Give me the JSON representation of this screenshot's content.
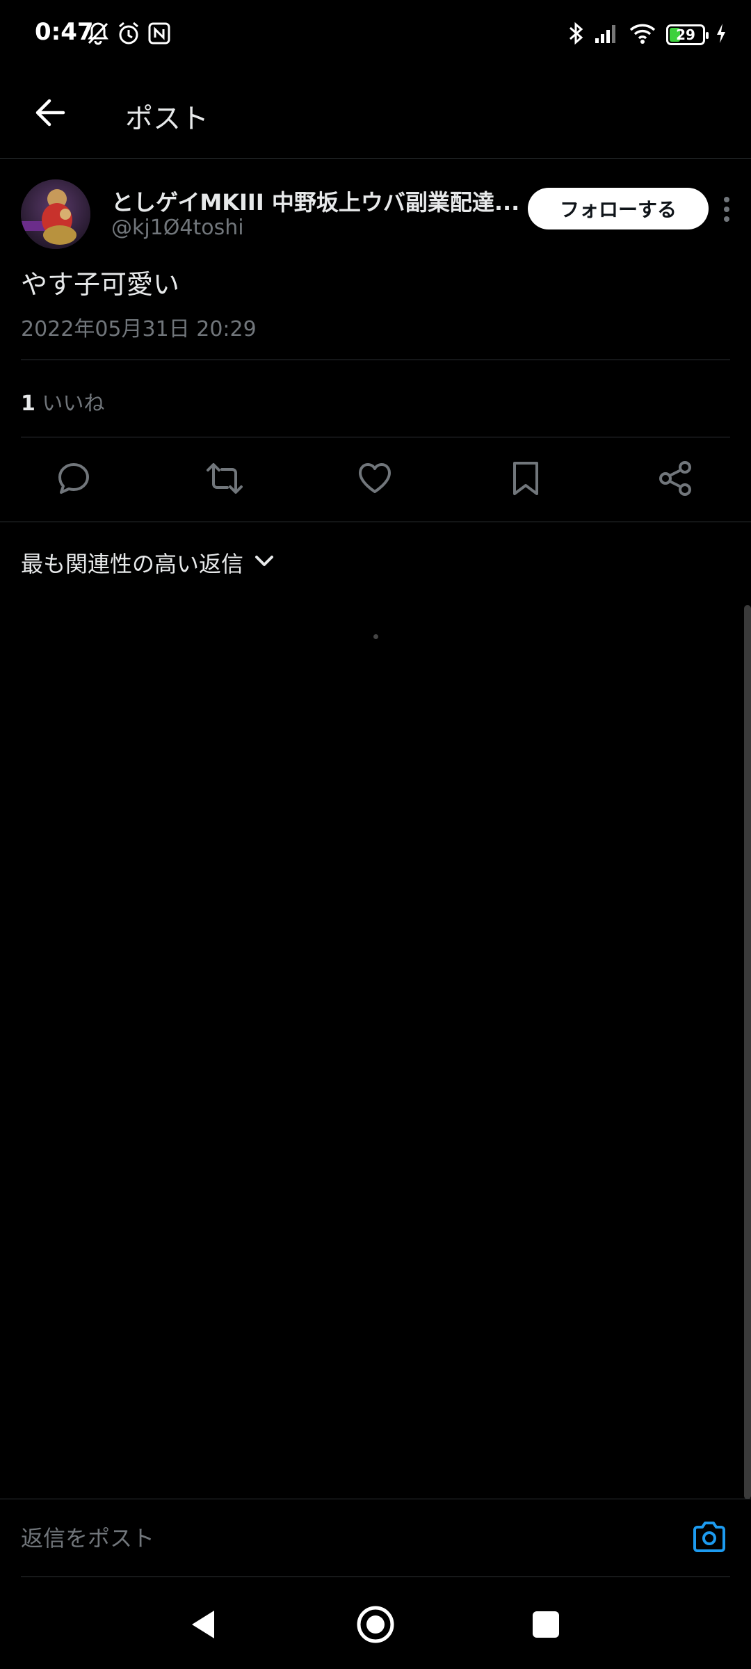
{
  "status_bar": {
    "time": "0:47",
    "battery_level": "29",
    "battery_fraction": 0.29,
    "icons_left": [
      "mute-bell-icon",
      "alarm-icon",
      "nfc-icon"
    ],
    "icons_right": [
      "bluetooth-icon",
      "signal-icon",
      "wifi-icon",
      "battery-icon",
      "charging-icon"
    ]
  },
  "header": {
    "title": "ポスト",
    "back_icon": "arrow-left-icon"
  },
  "post": {
    "user_name": "としゲイMKIII 中野坂上ウバ副業配達...",
    "user_handle": "@kj1Ø4toshi",
    "follow_label": "フォローする",
    "text": "やす子可愛い",
    "timestamp": "2022年05月31日 20:29",
    "likes_count": "1",
    "likes_label": "いいね"
  },
  "actions": [
    "reply-icon",
    "repost-icon",
    "like-icon",
    "bookmark-icon",
    "share-icon"
  ],
  "replies": {
    "sort_label": "最も関連性の高い返信"
  },
  "composer": {
    "placeholder": "返信をポスト"
  },
  "colors": {
    "background": "#000000",
    "text": "#e7e9ea",
    "secondary_text": "#71767b",
    "divider": "#2f3336",
    "accent": "#1d9bf0",
    "battery": "#3dd13d"
  }
}
